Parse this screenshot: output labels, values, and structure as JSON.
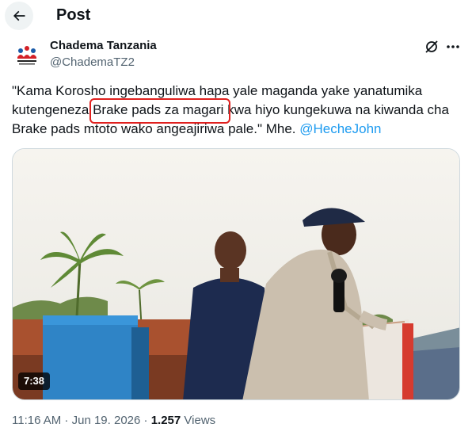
{
  "header": {
    "title": "Post",
    "back_icon": "arrow-left-icon"
  },
  "author": {
    "name": "Chadema Tanzania",
    "handle": "@ChademaTZ2",
    "avatar_text": "STRONGER TOGETHER"
  },
  "actions": {
    "grok_icon": "grok-icon",
    "more_icon": "more-horizontal-icon"
  },
  "tweet": {
    "line1": "\"Kama Korosho ingebanguliwa hapa yale maganda yake yanatumika",
    "line2_before": "kutengeneza ",
    "line2_highlight": "Brake pads za magari",
    "line2_after": " kwa hiyo kungekuwa na kiwanda cha",
    "line3": "Brake pads mtoto wako angeajiriwa pale.\" Mhe. ",
    "mention": "@HecheJohn"
  },
  "annotation": {
    "color": "#e0201e"
  },
  "media": {
    "duration": "7:38"
  },
  "meta": {
    "time": "11:16 AM",
    "separator1": " · ",
    "date": "Jun 19, 2026",
    "separator2": " · ",
    "views_count": "1,257",
    "views_label": " Views"
  },
  "colors": {
    "text": "#0f1419",
    "secondary": "#536471",
    "link": "#1d9bf0"
  }
}
